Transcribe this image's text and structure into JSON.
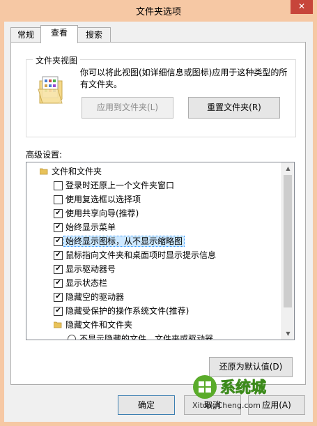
{
  "window": {
    "title": "文件夹选项",
    "close_glyph": "✕"
  },
  "tabs": [
    {
      "label": "常规"
    },
    {
      "label": "查看"
    },
    {
      "label": "搜索"
    }
  ],
  "folder_views": {
    "legend": "文件夹视图",
    "description": "你可以将此视图(如详细信息或图标)应用于这种类型的所有文件夹。",
    "apply_button": "应用到文件夹(L)",
    "reset_button": "重置文件夹(R)"
  },
  "advanced": {
    "label": "高级设置:",
    "items": [
      {
        "type": "folder",
        "label": "文件和文件夹"
      },
      {
        "type": "checkbox",
        "label": "登录时还原上一个文件夹窗口",
        "checked": false
      },
      {
        "type": "checkbox",
        "label": "使用复选框以选择项",
        "checked": false
      },
      {
        "type": "checkbox",
        "label": "使用共享向导(推荐)",
        "checked": true
      },
      {
        "type": "checkbox",
        "label": "始终显示菜单",
        "checked": true
      },
      {
        "type": "checkbox",
        "label": "始终显示图标，从不显示缩略图",
        "checked": true,
        "selected": true
      },
      {
        "type": "checkbox",
        "label": "鼠标指向文件夹和桌面项时显示提示信息",
        "checked": true
      },
      {
        "type": "checkbox",
        "label": "显示驱动器号",
        "checked": true
      },
      {
        "type": "checkbox",
        "label": "显示状态栏",
        "checked": true
      },
      {
        "type": "checkbox",
        "label": "隐藏空的驱动器",
        "checked": true
      },
      {
        "type": "checkbox",
        "label": "隐藏受保护的操作系统文件(推荐)",
        "checked": true
      },
      {
        "type": "folder",
        "label": "隐藏文件和文件夹"
      },
      {
        "type": "radio",
        "label": "不显示隐藏的文件、文件夹或驱动器"
      }
    ]
  },
  "restore_defaults_button": "还原为默认值(D)",
  "footer": {
    "ok": "确定",
    "cancel": "取消",
    "apply": "应用(A)"
  },
  "watermark": {
    "text": "系统城",
    "url": "XitongCheng.com"
  },
  "colors": {
    "title_bar": "#f6c8a4",
    "close_red": "#c7453a",
    "selection": "#cde8ff",
    "focus_border": "#3399ff"
  }
}
